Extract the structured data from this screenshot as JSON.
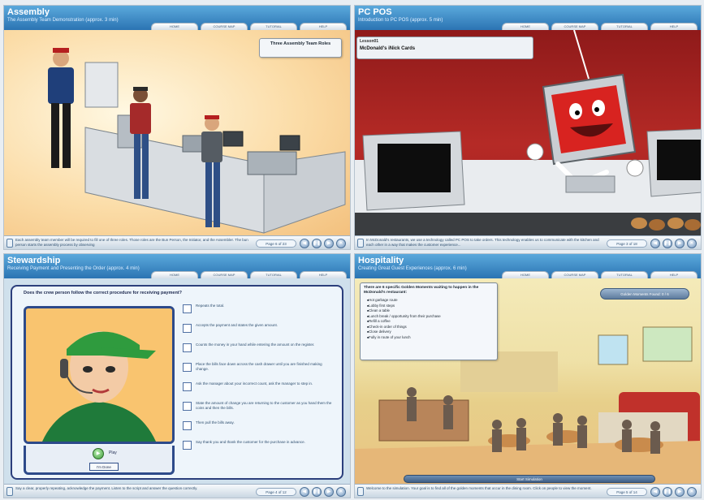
{
  "panels": [
    {
      "title": "Assembly",
      "subtitle": "The Assembly Team Demonstration (approx. 3 min)",
      "tabs": [
        "HOME",
        "COURSE MAP",
        "TUTORIAL",
        "HELP"
      ],
      "stage_label": "Three Assembly Team Roles",
      "caption": "Each assembly team member will be required to fill one of three roles. Those roles are the Bun Person, the Initiator, and the Assembler. The bun person starts the assembly process by observing",
      "page": "Page 6 of 23"
    },
    {
      "title": "PC POS",
      "subtitle": "Introduction to PC POS (approx. 5 min)",
      "tabs": [
        "HOME",
        "COURSE MAP",
        "TUTORIAL",
        "HELP"
      ],
      "lesson_small": "Lesson01",
      "lesson_title": "McDonald's iNick Cards",
      "caption": "In McDonald's restaurants, we use a technology called PC POS to take orders. This technology enables us to communicate with the kitchen and each other in a way that makes the customer experience...",
      "page": "Page 3 of 18"
    },
    {
      "title": "Stewardship",
      "subtitle": "Receiving Payment and Presenting the Order (approx. 4 min)",
      "tabs": [
        "HOME",
        "COURSE MAP",
        "TUTORIAL",
        "HELP"
      ],
      "question": "Does the crew person follow the correct procedure for receiving payment?",
      "options": [
        "Repeats the total.",
        "Accepts the payment and states the given amount.",
        "Counts the money in your hand while entering the amount on the register.",
        "Place the bills face down across the cash drawer until you are finished making change.",
        "Ask the manager about your incorrect count, ask the manager to step in.",
        "State the amount of change you are returning to the customer as you hand them the coins and then the bills.",
        "Then pull the bills away.",
        "Say thank you and thank the customer for the purchase in advance."
      ],
      "play_label": "Play",
      "done_label": "I'm Done",
      "caption": "Say a clear, properly repeating, acknowledge the payment. Listen to the script and answer the question correctly.",
      "page": "Page 4 of 12"
    },
    {
      "title": "Hospitality",
      "subtitle": "Creating Great Guest Experiences (approx. 6 min)",
      "tabs": [
        "HOME",
        "COURSE MAP",
        "TUTORIAL",
        "HELP"
      ],
      "list_header": "There are 6 specific Golden Moments waiting to happen in the McDonald's restaurant:",
      "list_items": [
        "Hot garbage route",
        "Lobby first steps",
        "Clean a table",
        "Lunch break / opportunity from their purchase",
        "Refill a coffee",
        "Check-in order of things",
        "Close delivery",
        "Fully in route of your lunch"
      ],
      "golden_button": "Golden Moments Found: 0 / 6",
      "start_button": "Start Simulation",
      "caption": "Welcome to the simulation. Your goal is to find all of the golden moments that occur in the dining room. Click on people to view the moment.",
      "page": "Page 5 of 14"
    }
  ],
  "nav": {
    "back": "◀",
    "pause": "❚❚",
    "forward": "▶",
    "exit": "✕"
  }
}
